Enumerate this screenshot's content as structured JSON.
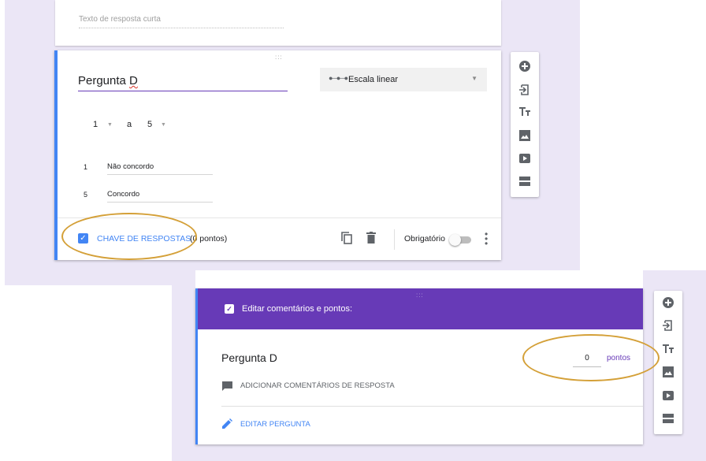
{
  "panel1": {
    "short_answer_placeholder": "Texto de resposta curta",
    "question_title_prefix": "Pergunta ",
    "question_title_suffix": "D",
    "question_type": "Escala linear",
    "scale_from": "1",
    "scale_to_label": "a",
    "scale_to": "5",
    "label1_num": "1",
    "label1_text": "Não concordo",
    "label5_num": "5",
    "label5_text": "Concordo",
    "answer_key_label": "CHAVE DE RESPOSTAS",
    "answer_key_points": "(0 pontos)",
    "required_label": "Obrigatório",
    "drag_handle": ":::"
  },
  "panel2": {
    "header_title": "Editar comentários e pontos:",
    "question_title": "Pergunta D",
    "points_value": "0",
    "points_label": "pontos",
    "add_feedback_label": "ADICIONAR COMENTÁRIOS DE RESPOSTA",
    "edit_question_label": "EDITAR PERGUNTA",
    "drag_handle": ":::"
  },
  "colors": {
    "accent_purple": "#673ab7",
    "accent_blue": "#4285f4",
    "highlight_oval": "#d4a038",
    "background": "#ebe6f6"
  },
  "icons": {
    "toolbar": [
      "add-question-icon",
      "import-question-icon",
      "title-icon",
      "image-icon",
      "video-icon",
      "section-icon"
    ]
  }
}
